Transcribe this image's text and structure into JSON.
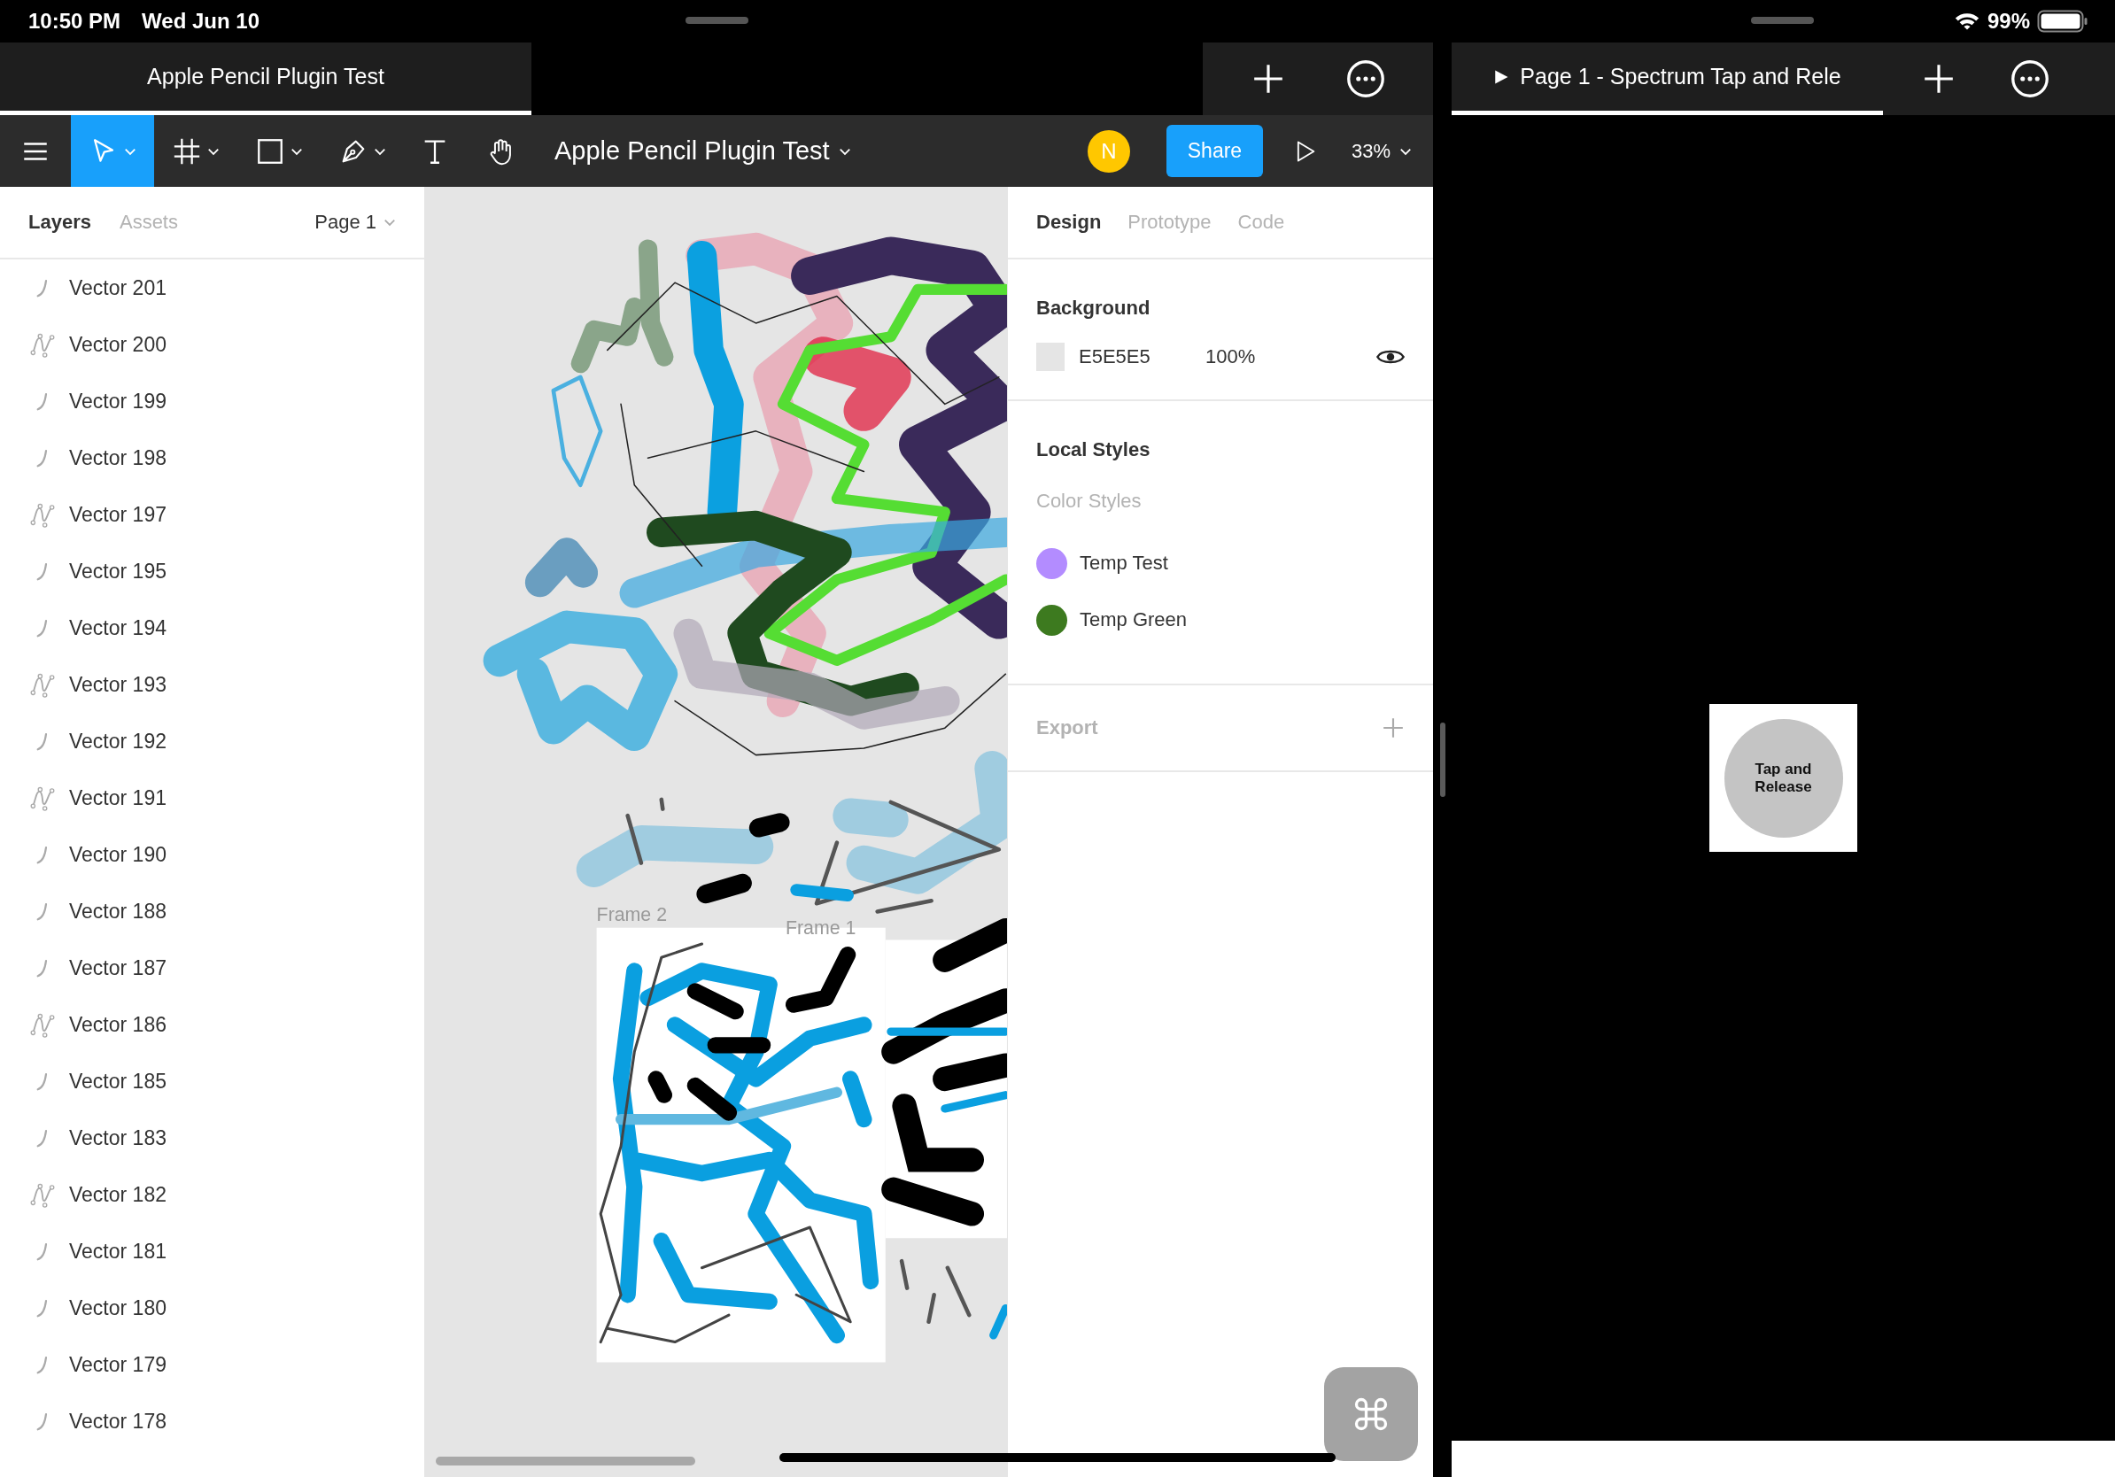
{
  "status_bar": {
    "time": "10:50 PM",
    "date": "Wed Jun 10",
    "battery_text": "99%"
  },
  "figma": {
    "tabs": [
      {
        "title": "Apple Pencil Plugin Test",
        "selected": true
      }
    ],
    "toolbar": {
      "tools": [
        {
          "kind": "menu",
          "selected": false
        },
        {
          "kind": "move",
          "selected": true
        },
        {
          "kind": "frame",
          "selected": false
        },
        {
          "kind": "rectangle",
          "selected": false
        },
        {
          "kind": "pen",
          "selected": false
        },
        {
          "kind": "text",
          "selected": false
        },
        {
          "kind": "hand",
          "selected": false
        }
      ],
      "file_title": "Apple Pencil Plugin Test",
      "avatar": "N",
      "share": "Share",
      "zoom": "33%"
    },
    "layers_panel": {
      "tabs": [
        {
          "label": "Layers",
          "selected": true
        },
        {
          "label": "Assets",
          "selected": false
        }
      ],
      "page": "Page 1",
      "layers": [
        {
          "name": "Vector 201",
          "kind": "stroke"
        },
        {
          "name": "Vector 200",
          "kind": "path"
        },
        {
          "name": "Vector 199",
          "kind": "stroke"
        },
        {
          "name": "Vector 198",
          "kind": "stroke"
        },
        {
          "name": "Vector 197",
          "kind": "path"
        },
        {
          "name": "Vector 195",
          "kind": "stroke"
        },
        {
          "name": "Vector 194",
          "kind": "stroke"
        },
        {
          "name": "Vector 193",
          "kind": "path"
        },
        {
          "name": "Vector 192",
          "kind": "stroke"
        },
        {
          "name": "Vector 191",
          "kind": "path"
        },
        {
          "name": "Vector 190",
          "kind": "stroke"
        },
        {
          "name": "Vector 188",
          "kind": "stroke"
        },
        {
          "name": "Vector 187",
          "kind": "stroke"
        },
        {
          "name": "Vector 186",
          "kind": "path"
        },
        {
          "name": "Vector 185",
          "kind": "stroke"
        },
        {
          "name": "Vector 183",
          "kind": "stroke"
        },
        {
          "name": "Vector 182",
          "kind": "path"
        },
        {
          "name": "Vector 181",
          "kind": "stroke"
        },
        {
          "name": "Vector 180",
          "kind": "stroke"
        },
        {
          "name": "Vector 179",
          "kind": "stroke"
        },
        {
          "name": "Vector 178",
          "kind": "stroke"
        }
      ]
    },
    "canvas": {
      "frames": [
        {
          "label": "Frame 2"
        },
        {
          "label": "Frame 1"
        }
      ]
    },
    "design_panel": {
      "tabs": [
        {
          "label": "Design",
          "selected": true
        },
        {
          "label": "Prototype",
          "selected": false
        },
        {
          "label": "Code",
          "selected": false
        }
      ],
      "background": {
        "title": "Background",
        "hex": "E5E5E5",
        "opacity": "100%"
      },
      "local_styles": {
        "title": "Local Styles",
        "subtitle": "Color Styles",
        "styles": [
          {
            "name": "Temp Test",
            "color": "#b38cff"
          },
          {
            "name": "Temp Green",
            "color": "#3d7a1f"
          }
        ]
      },
      "export": {
        "title": "Export"
      }
    }
  },
  "prototype": {
    "tab": {
      "title": "Page 1 - Spectrum Tap and Rele",
      "selected": true
    },
    "button": {
      "label": "Tap and Release"
    }
  }
}
